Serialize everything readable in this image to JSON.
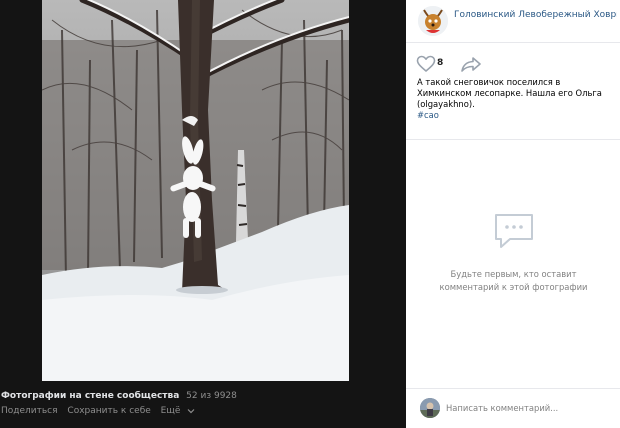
{
  "viewer": {
    "album_title": "Фотографии на стене сообщества",
    "counter": "52 из 9928",
    "actions": {
      "share": "Поделиться",
      "save": "Сохранить к себе",
      "more": "Ещё"
    }
  },
  "panel": {
    "group_name": "Головинский Левобережный Ховрино",
    "likes": "8",
    "post_text": "А такой снеговичок поселился в Химкинском лесопарке. Нашла его Ольга (olgayakhno).",
    "hashtag": "#сао",
    "empty_comments": "Будьте первым, кто оставит комментарий к этой фотографии",
    "comment_placeholder": "Написать комментарий..."
  },
  "colors": {
    "link": "#2a5885",
    "muted": "#828282",
    "viewer_bg": "#141414"
  },
  "icons": [
    "heart-icon",
    "share-arrow-icon",
    "comments-empty-icon",
    "chevron-down-icon"
  ]
}
